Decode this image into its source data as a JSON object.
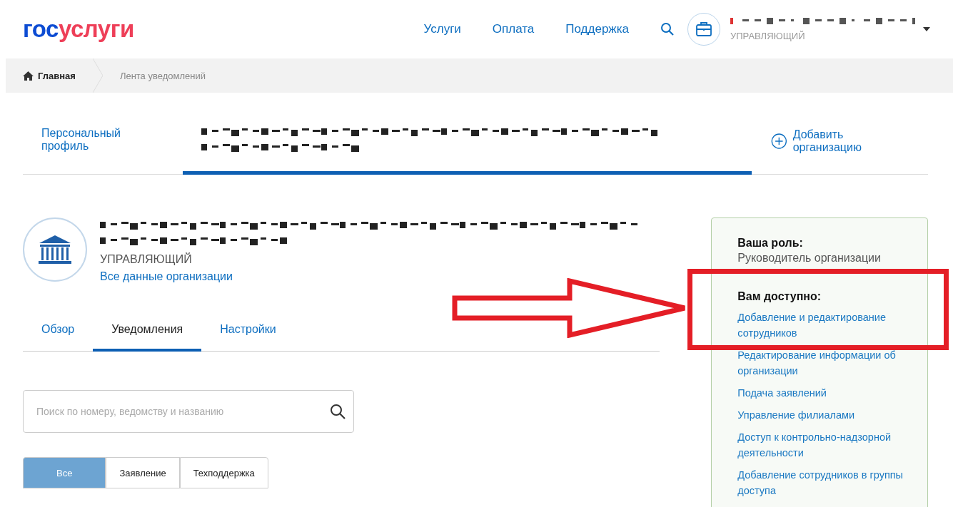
{
  "header": {
    "logo": {
      "prefix": "гос",
      "suffix": "услуги"
    },
    "nav": [
      "Услуги",
      "Оплата",
      "Поддержка"
    ],
    "account": {
      "role": "УПРАВЛЯЮЩИЙ",
      "name_redacted": true
    }
  },
  "breadcrumbs": [
    {
      "label": "Главная",
      "kind": "home"
    },
    {
      "label": "Лента уведомлений",
      "kind": "current"
    }
  ],
  "profile_tabs": [
    {
      "label": "Персональный профиль",
      "selected": false,
      "kind": "text"
    },
    {
      "kind": "redacted",
      "selected": true
    }
  ],
  "add_organization": "Добавить организацию",
  "organization": {
    "role": "УПРАВЛЯЮЩИЙ",
    "all_data_link": "Все данные организации"
  },
  "tabs": [
    {
      "label": "Обзор",
      "selected": false
    },
    {
      "label": "Уведомления",
      "selected": true
    },
    {
      "label": "Настройки",
      "selected": false
    }
  ],
  "search": {
    "placeholder": "Поиск по номеру, ведомству и названию"
  },
  "filters": [
    {
      "label": "Все",
      "selected": true
    },
    {
      "label": "Заявление",
      "selected": false
    },
    {
      "label": "Техподдержка",
      "selected": false
    }
  ],
  "role_panel": {
    "role_title": "Ваша роль:",
    "role": "Руководитель организации",
    "access_title": "Вам доступно:",
    "permissions": [
      "Добавление и редактирование сотрудников",
      "Редактирование информации об организации",
      "Подача заявлений",
      "Управление филиалами",
      "Доступ к контрольно-надзорной деятельности",
      "Добавление сотрудников в группы доступа"
    ]
  },
  "annotations": {
    "arrow": true,
    "frame": true
  }
}
